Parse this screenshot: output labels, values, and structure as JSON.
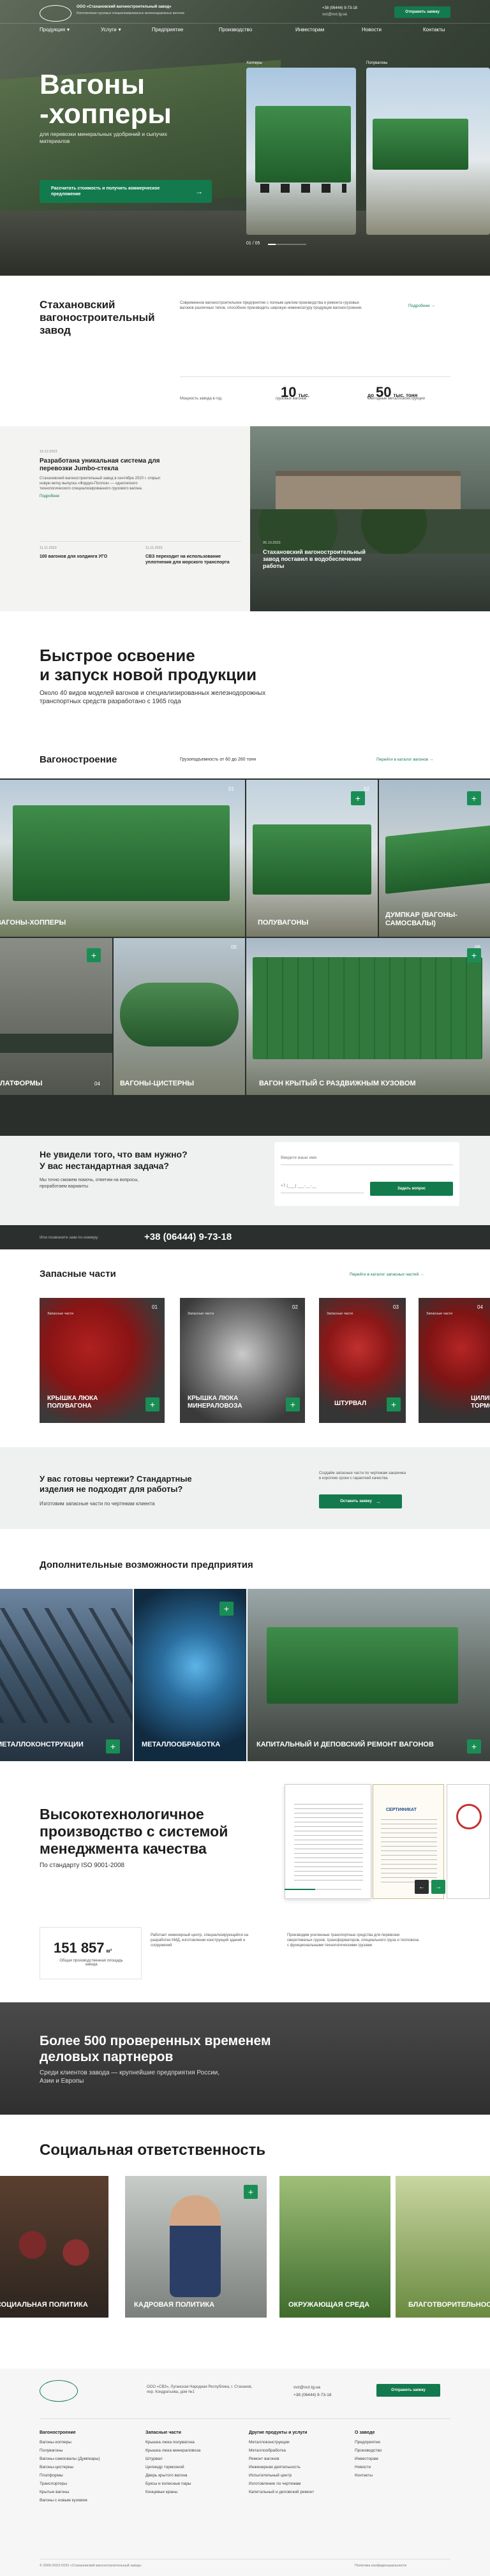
{
  "header": {
    "company_name": "ООО «Стахановский вагоностроительный завод»",
    "company_desc": "Изготовление грузовых специализированных железнодорожных вагонов",
    "nav": [
      "Продукция",
      "Услуги",
      "Предприятие",
      "Производство",
      "Инвесторам",
      "Новости",
      "Контакты"
    ],
    "phone": "+38 (06444) 9-73-18",
    "email": "svz@svz.lg.ua",
    "cta": "Отправить заявку"
  },
  "hero": {
    "title_line1": "Вагоны",
    "title_line2": "-хопперы",
    "subtitle": "для перевозки минеральных удобрений и сыпучих материалов",
    "button": "Рассчитать стоимость и получить коммерческое предложение",
    "card1_label": "Хопперы",
    "card2_label": "Полувагоны",
    "slide_counter": "01 / 05"
  },
  "about": {
    "title": "Стахановский вагоностроительный завод",
    "desc": "Современное вагоностроительное предприятие с полным циклом производства и ремонта грузовых вагонов различных типов, способное производить широкую номенклатуру продукции вагоностроения.",
    "link": "Подробнее",
    "stat1_prefix": "Мощность завода в год",
    "stat1_value": "10",
    "stat1_unit": "тыс.",
    "stat1_desc": "грузовых вагонов",
    "stat2_prefix": "до",
    "stat2_value": "50",
    "stat2_unit": "тыс. тонн",
    "stat2_desc": "ежегодные металлоконструкции"
  },
  "news": {
    "item1_date": "19.12.2023",
    "item1_title": "Разработана уникальная система для перевозки Jumbo-стекла",
    "item1_text": "Стахановский вагоностроительный завод в сентябре 2020 г. открыл новую ветку выпуска «Фордиз-Поллок» — однотипного технологического специализированного грузового вагона.",
    "item1_link": "Подробнее",
    "item2_date": "11.11.2023",
    "item2_title": "100 вагонов для холдинга УГО",
    "item3_date": "11.11.2023",
    "item3_title": "СВЗ переходит на использование уплотнения для морского транспорта",
    "item4_date": "05.10.2023",
    "item4_title": "Стахановский вагоностроительный завод поставил в водобеспечение работы"
  },
  "fast": {
    "title_line1": "Быстрое освоение",
    "title_line2": "и запуск новой продукции",
    "text": "Около 40 видов моделей вагонов и специализированных железнодорожных транспортных средств разработано с 1965 года"
  },
  "products": {
    "title": "Вагоностроение",
    "capacity": "Грузоподъемность от 60 до 260 тонн",
    "link": "Перейти в каталог вагонов",
    "tiles": [
      {
        "num": "01",
        "label": "Вагоны-хопперы"
      },
      {
        "num": "02",
        "label": "Полувагоны"
      },
      {
        "num": "03",
        "label": "Думпкар (вагоны-самосвалы)"
      },
      {
        "num": "04",
        "label": "Платформы"
      },
      {
        "num": "05",
        "label": "Вагоны-цистерны"
      },
      {
        "num": "06",
        "label": "Вагон крытый с раздвижным кузовом"
      }
    ]
  },
  "request": {
    "title_line1": "Не увидели того, что вам нужно?",
    "title_line2": "У вас нестандартная задача?",
    "text": "Мы точно сможем помочь, ответим на вопросы, проработаем варианты",
    "placeholder_name": "Введите ваше имя",
    "placeholder_phone": "+7 (___) ___-__-__",
    "button": "Задать вопрос"
  },
  "strip": {
    "label": "Или позвоните нам по номеру:",
    "phone": "+38 (06444) 9-73-18"
  },
  "parts": {
    "title": "Запасные части",
    "link": "Перейти в каталог запасных частей",
    "tiles": [
      {
        "num": "01",
        "cat": "Запасные части",
        "label": "Крышка люка полувагона"
      },
      {
        "num": "02",
        "cat": "Запасные части",
        "label": "Крышка люка минераловоза"
      },
      {
        "num": "03",
        "cat": "Запасные части",
        "label": "Штурвал"
      },
      {
        "num": "04",
        "cat": "Запасные части",
        "label": "Цилиндр тормозной"
      }
    ]
  },
  "drawings": {
    "title_line1": "У вас готовы чертежи? Стандартные",
    "title_line2": "изделия не подходят для работы?",
    "text": "Изготовим запасные части по чертежам клиента",
    "side_text": "Создаём запасные части по чертежам заказчика в короткие сроки с гарантией качества",
    "button": "Оставить заявку"
  },
  "capabilities": {
    "title": "Дополнительные возможности предприятия",
    "tiles": [
      {
        "label": "Металлоконструкции"
      },
      {
        "label": "Металлообработка"
      },
      {
        "label": "Капитальный и деповский ремонт вагонов"
      }
    ]
  },
  "quality": {
    "title_line1": "Высокотехнологичное",
    "title_line2": "производство с системой",
    "title_line3": "менеджмента качества",
    "text": "По стандарту ISO 9001-2008",
    "cert_title": "СЕРТИФИКАТ"
  },
  "area": {
    "value": "151 857",
    "unit": "м²",
    "desc": "Общая производственная площадь завода",
    "col1": "Работает инженерный центр, специализирующийся на разработке КМД, изготовлении конструкций зданий и сооружений",
    "col2": "Производим усиленные транспортные средства для перевозки сверхтяжелых грузов, трансформаторов, специального груза и тепловоза с функциональными технологическими грузами"
  },
  "partners": {
    "title_line1": "Более 500 проверенных временем",
    "title_line2": "деловых партнеров",
    "text": "Среди клиентов завода — крупнейшие предприятия России, Азии и Европы"
  },
  "social": {
    "title": "Социальная ответственность",
    "tiles": [
      {
        "label": "Социальная политика"
      },
      {
        "label": "Кадровая политика"
      },
      {
        "label": "Окружающая среда"
      },
      {
        "label": "Благотворительность"
      }
    ]
  },
  "footer": {
    "address": "ООО «СВЗ», Луганская Народная Республика, г. Стаханов, пер. Кондратьева, дом №1",
    "email": "svz@svz.lg.ua",
    "phone": "+38 (06444) 9-73-18",
    "button": "Отправить заявку",
    "col1_title": "Вагоностроение",
    "col1_items": [
      "Вагоны-хопперы",
      "Полувагоны",
      "Вагоны-самосвалы (Думпкары)",
      "Вагоны-цистерны",
      "Платформы",
      "Транспортеры",
      "Крытые вагоны",
      "Вагоны с новым кузовом"
    ],
    "col2_title": "Запасные части",
    "col2_items": [
      "Крышка люка полувагона",
      "Крышка люка минераловоза",
      "Штурвал",
      "Цилиндр тормозной",
      "Дверь крытого вагона",
      "Буксы и колесные пары",
      "Концевые краны"
    ],
    "col3_title": "Другие продукты и услуги",
    "col3_items": [
      "Металлоконструкции",
      "Металлообработка",
      "Ремонт вагонов",
      "Инженерная деятельность",
      "Испытательный центр",
      "Изготовление по чертежам",
      "Капитальный и деповский ремонт"
    ],
    "col4_title": "О заводе",
    "col4_items": [
      "Предприятие",
      "Производство",
      "Инвесторам",
      "Новости",
      "Контакты"
    ],
    "copyright": "© 2000-2023 ООО «Стахановский вагоностроительный завод»",
    "policy": "Политика конфиденциальности"
  }
}
